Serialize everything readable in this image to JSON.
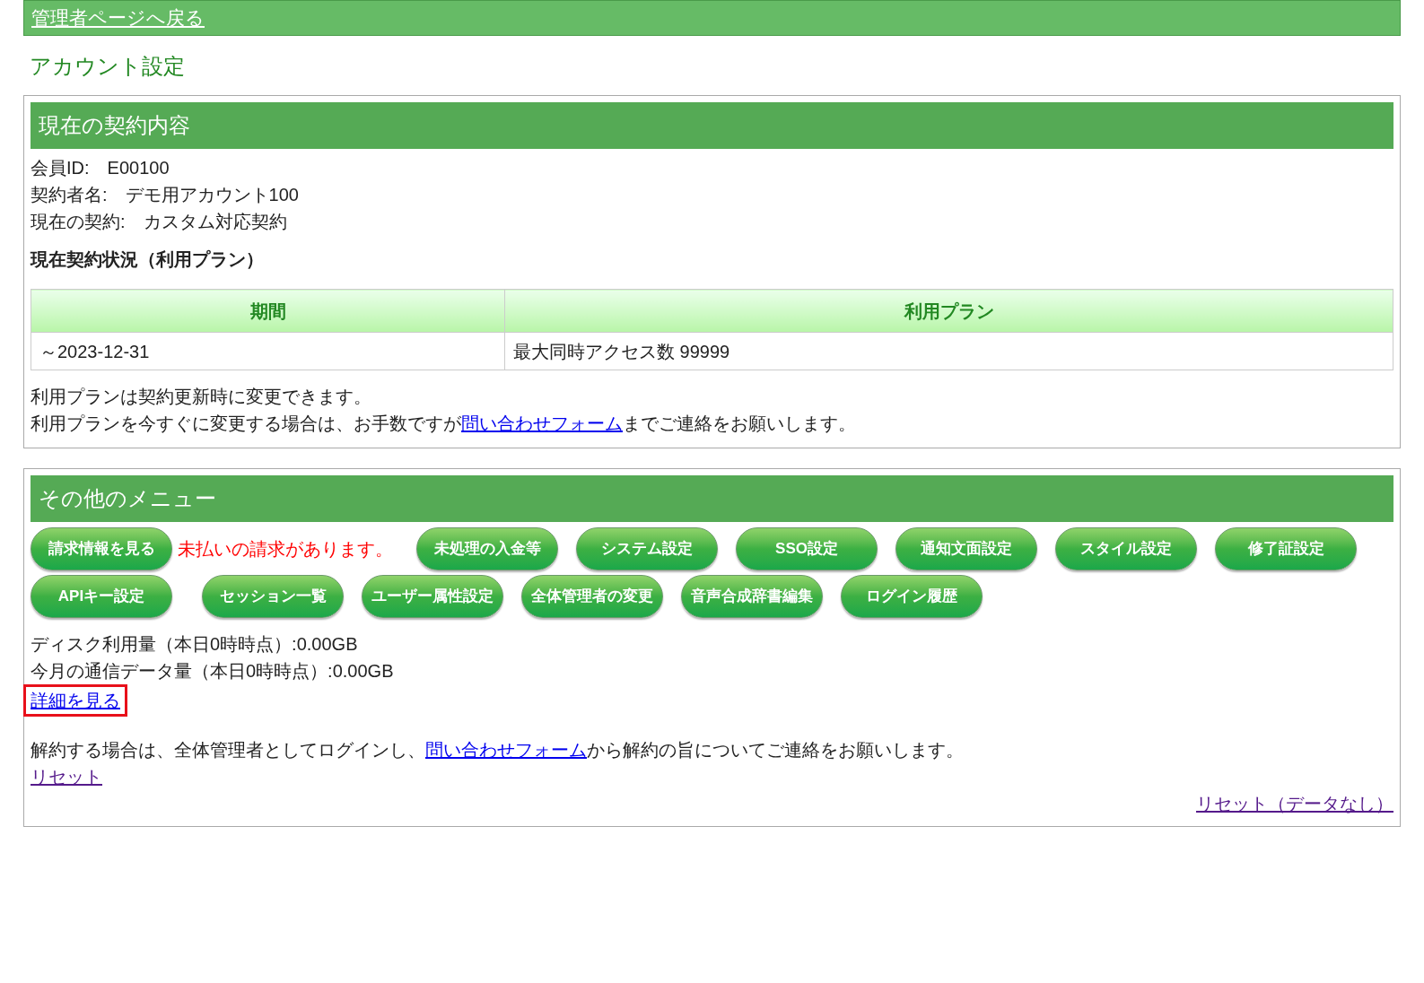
{
  "back_link": "管理者ページへ戻る",
  "page_title": "アカウント設定",
  "contract": {
    "heading": "現在の契約内容",
    "fields": [
      {
        "label": "会員ID:",
        "value": "E00100"
      },
      {
        "label": "契約者名:",
        "value": "デモ用アカウント100"
      },
      {
        "label": "現在の契約:",
        "value": "カスタム対応契約"
      }
    ],
    "status_heading": "現在契約状況（利用プラン）",
    "table": {
      "columns": [
        "期間",
        "利用プラン"
      ],
      "rows": [
        [
          "～2023-12-31",
          "最大同時アクセス数 99999"
        ]
      ]
    },
    "note": "利用プランは契約更新時に変更できます。",
    "note2": {
      "before": "利用プランを今すぐに変更する場合は、お手数ですが",
      "link": "問い合わせフォーム",
      "after": "までご連絡をお願いします。"
    }
  },
  "menu": {
    "heading": "その他のメニュー",
    "items": [
      {
        "kind": "button",
        "label": "請求情報を見る"
      },
      {
        "kind": "alert",
        "label": "未払いの請求があります。"
      },
      {
        "kind": "button",
        "label": "未処理の入金等"
      },
      {
        "kind": "button",
        "label": "システム設定"
      },
      {
        "kind": "button",
        "label": "SSO設定"
      },
      {
        "kind": "button",
        "label": "通知文面設定"
      },
      {
        "kind": "button",
        "label": "スタイル設定"
      },
      {
        "kind": "button",
        "label": "修了証設定"
      },
      {
        "kind": "button",
        "label": "APIキー設定"
      },
      {
        "kind": "button",
        "label": "セッション一覧"
      },
      {
        "kind": "button",
        "label": "ユーザー属性設定"
      },
      {
        "kind": "button",
        "label": "全体管理者の変更"
      },
      {
        "kind": "button",
        "label": "音声合成辞書編集"
      },
      {
        "kind": "button",
        "label": "ログイン履歴"
      }
    ],
    "usage": [
      "ディスク利用量（本日0時時点）:0.00GB",
      "今月の通信データ量（本日0時時点）:0.00GB"
    ],
    "detail_link": {
      "label": "詳細を見る",
      "highlighted": true
    },
    "cancel_note": {
      "before": "解約する場合は、全体管理者としてログインし、",
      "link": "問い合わせフォーム",
      "after": "から解約の旨についてご連絡をお願いします。"
    },
    "reset_link": "リセット",
    "reset_nodata_link": "リセット（データなし）"
  }
}
